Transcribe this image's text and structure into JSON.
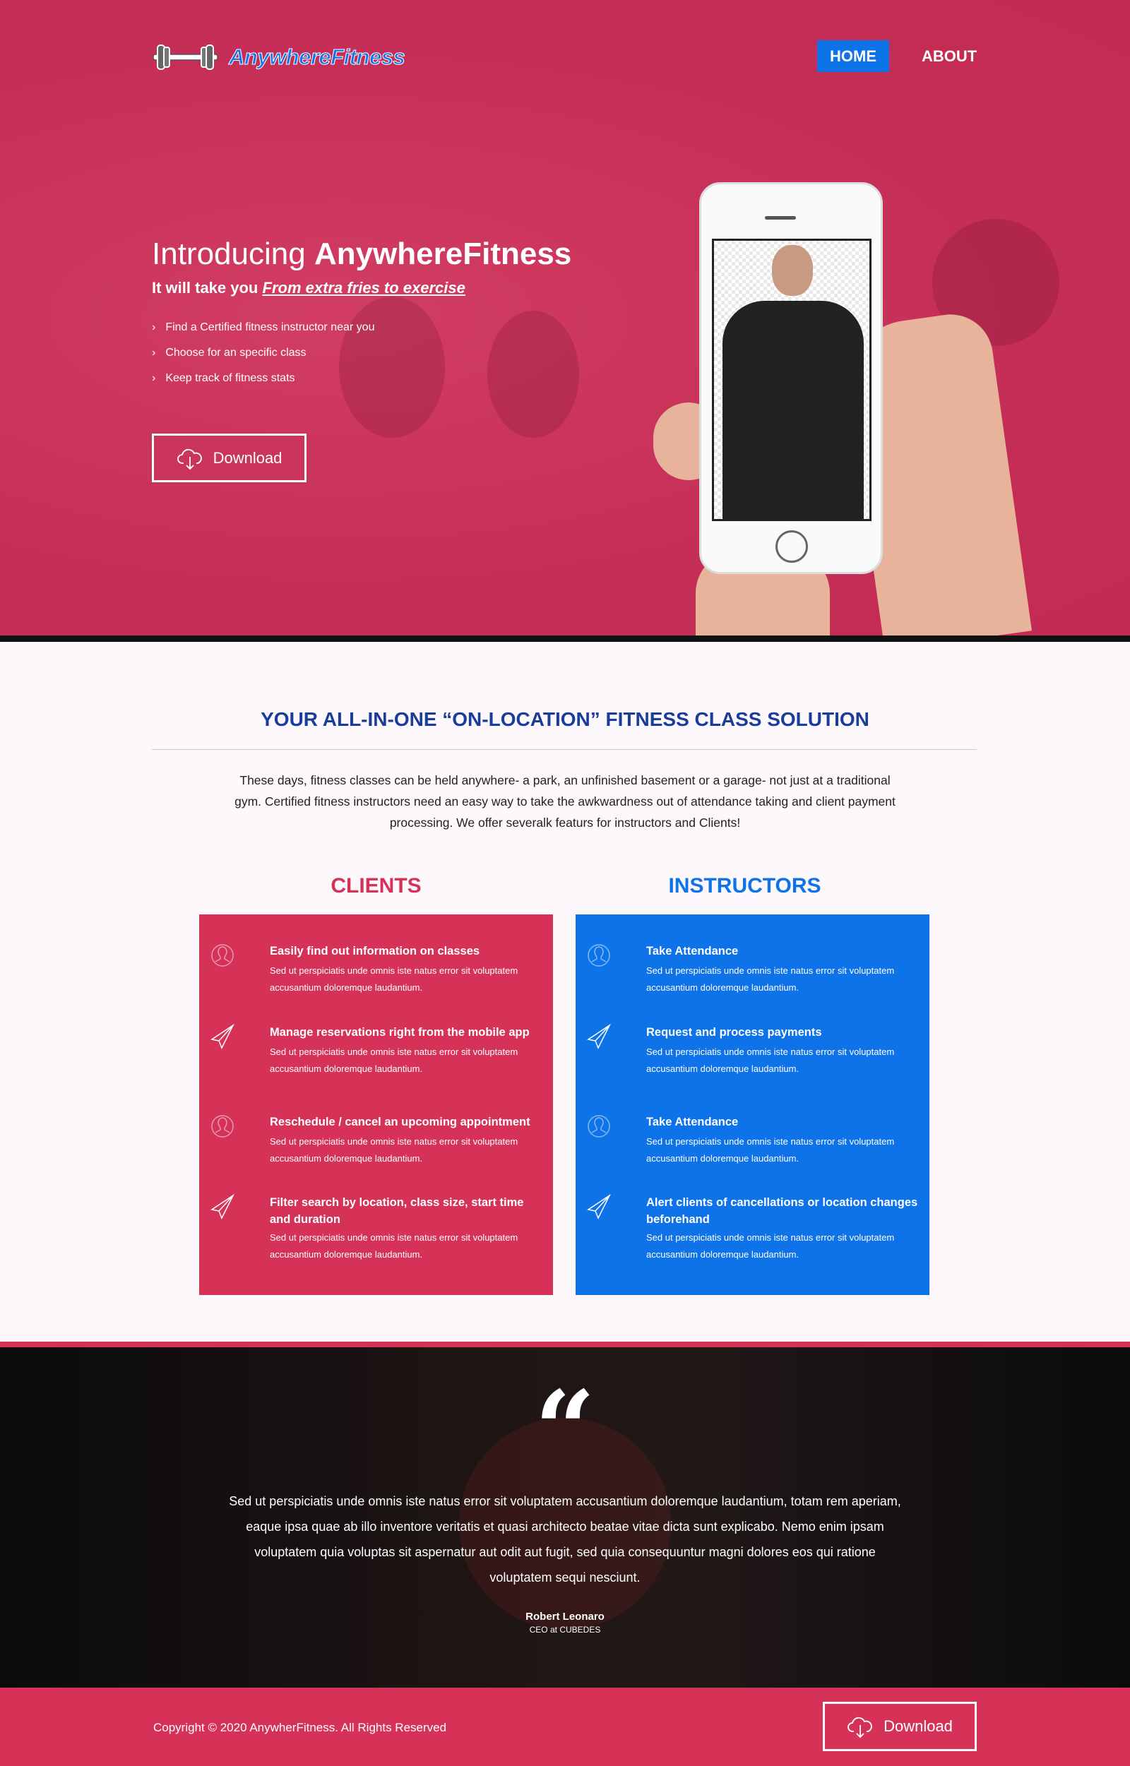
{
  "colors": {
    "brand_pink": "#d63258",
    "brand_blue": "#0e73e8",
    "heading_blue": "#1a3d9c"
  },
  "nav": {
    "logo_text": "AnywhereFitness",
    "logo_icon": "dumbbell-icon",
    "home": "HOME",
    "about": "ABOUT",
    "active": "HOME"
  },
  "hero": {
    "title_light": "Introducing",
    "title_bold": "AnywhereFitness",
    "subtitle_prefix": "It will take you",
    "subtitle_emph": "From extra fries to exercise",
    "bullets": [
      "Find a Certified fitness instructor near you",
      "Choose for an specific class",
      "Keep track of fitness stats"
    ],
    "download": "Download"
  },
  "solution": {
    "title": "YOUR ALL-IN-ONE “ON-LOCATION” FITNESS CLASS SOLUTION",
    "text": "These days, fitness classes can be held anywhere- a park, an unfinished basement or a garage- not just at a traditional gym. Certified fitness instructors need an easy way to take the awkwardness out of attendance taking and client payment processing. We offer severalk featurs for instructors and Clients!"
  },
  "clients": {
    "heading": "CLIENTS",
    "items": [
      {
        "icon": "user-icon",
        "title": "Easily find out information on classes",
        "text": "Sed ut perspiciatis unde omnis iste natus error sit voluptatem accusantium doloremque laudantium."
      },
      {
        "icon": "paper-plane-icon",
        "title": "Manage reservations right from the mobile app",
        "text": "Sed ut perspiciatis unde omnis iste natus error sit voluptatem accusantium doloremque laudantium."
      },
      {
        "icon": "user-icon",
        "title": "Reschedule / cancel an upcoming appointment",
        "text": "Sed ut perspiciatis unde omnis iste natus error sit voluptatem accusantium doloremque laudantium."
      },
      {
        "icon": "paper-plane-icon",
        "title": "Filter search by location, class size, start time and duration",
        "text": "Sed ut perspiciatis unde omnis iste natus error sit voluptatem accusantium doloremque laudantium."
      }
    ]
  },
  "instructors": {
    "heading": "INSTRUCTORS",
    "items": [
      {
        "icon": "user-icon",
        "title": "Take Attendance",
        "text": "Sed ut perspiciatis unde omnis iste natus error sit voluptatem accusantium doloremque laudantium."
      },
      {
        "icon": "paper-plane-icon",
        "title": "Request and process payments",
        "text": "Sed ut perspiciatis unde omnis iste natus error sit voluptatem accusantium doloremque laudantium."
      },
      {
        "icon": "user-icon",
        "title": "Take Attendance",
        "text": "Sed ut perspiciatis unde omnis iste natus error sit voluptatem accusantium doloremque laudantium."
      },
      {
        "icon": "paper-plane-icon",
        "title": "Alert clients of cancellations or location changes beforehand",
        "text": "Sed ut perspiciatis unde omnis iste natus error sit voluptatem accusantium doloremque laudantium."
      }
    ]
  },
  "testimonial": {
    "mark": "“",
    "text": "Sed ut perspiciatis unde omnis iste natus error sit voluptatem accusantium doloremque laudantium, totam rem aperiam, eaque ipsa quae ab illo inventore veritatis et quasi architecto beatae vitae dicta sunt explicabo. Nemo enim ipsam voluptatem quia voluptas sit aspernatur aut odit aut fugit, sed quia consequuntur magni dolores eos qui ratione voluptatem sequi nesciunt.",
    "name": "Robert Leonaro",
    "role": "CEO at CUBEDES"
  },
  "footer": {
    "copyright": "Copyright © 2020 AnywherFitness. All Rights Reserved",
    "download": "Download"
  }
}
